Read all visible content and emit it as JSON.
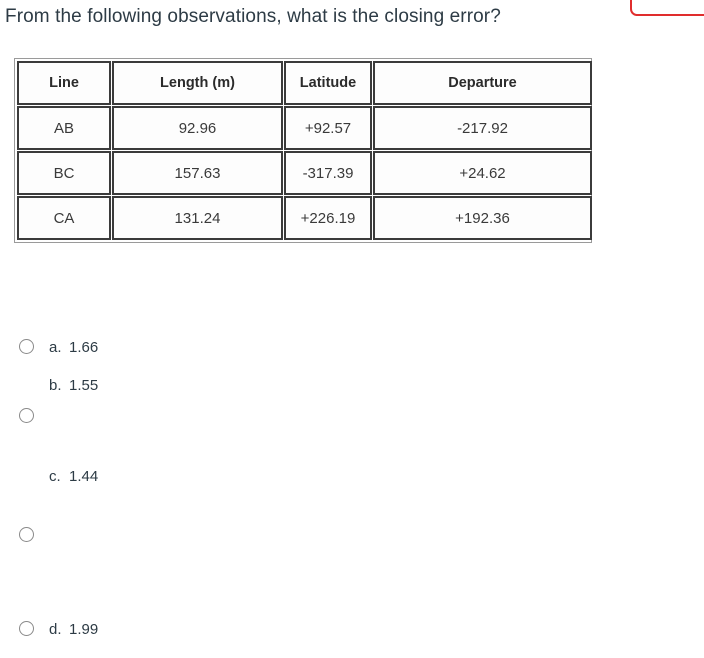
{
  "question": {
    "prompt": "From the following observations, what is the closing error?"
  },
  "annotation": {
    "highlight_color": "#e02d2d",
    "shape": "rounded-rectangle-outline-clipped"
  },
  "table": {
    "headers": [
      "Line",
      "Length (m)",
      "Latitude",
      "Departure"
    ],
    "rows": [
      {
        "line": "AB",
        "length": "92.96",
        "latitude": "+92.57",
        "departure": "-217.92"
      },
      {
        "line": "BC",
        "length": "157.63",
        "latitude": "-317.39",
        "departure": "+24.62"
      },
      {
        "line": "CA",
        "length": "131.24",
        "latitude": "+226.19",
        "departure": "+192.36"
      }
    ]
  },
  "options": [
    {
      "letter": "a.",
      "value": "1.66",
      "selected": false
    },
    {
      "letter": "b.",
      "value": "1.55",
      "selected": false
    },
    {
      "letter": "c.",
      "value": "1.44",
      "selected": false
    },
    {
      "letter": "d.",
      "value": "1.99",
      "selected": false
    }
  ]
}
